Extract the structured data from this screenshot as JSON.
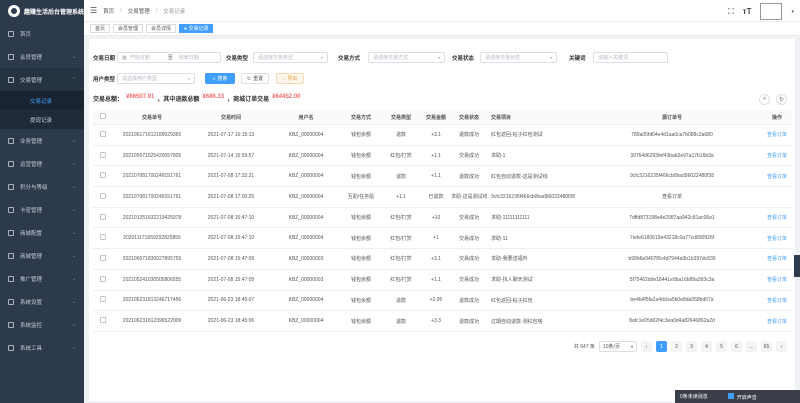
{
  "app": {
    "title": "趣赚生活后台管理系统"
  },
  "sidebar": {
    "items": [
      {
        "label": "首页",
        "icon": "home-icon"
      },
      {
        "label": "会员管理",
        "icon": "user-icon"
      },
      {
        "label": "交易管理",
        "icon": "trade-icon",
        "open": true
      },
      {
        "label": "业务管理",
        "icon": "business-icon"
      },
      {
        "label": "运营管理",
        "icon": "operation-icon"
      },
      {
        "label": "积分与等级",
        "icon": "points-icon"
      },
      {
        "label": "卡密管理",
        "icon": "card-icon"
      },
      {
        "label": "商城配置",
        "icon": "mall-config-icon"
      },
      {
        "label": "商城管理",
        "icon": "mall-icon"
      },
      {
        "label": "推广管理",
        "icon": "promotion-icon"
      },
      {
        "label": "系统设置",
        "icon": "settings-icon"
      },
      {
        "label": "系统监控",
        "icon": "monitor-icon"
      },
      {
        "label": "系统工具",
        "icon": "tools-icon"
      }
    ],
    "subitems": [
      {
        "label": "交易记录",
        "active": true
      },
      {
        "label": "提现记录",
        "active": false
      }
    ]
  },
  "topbar": {
    "breadcrumb": [
      "首页",
      "交易管理",
      "交易记录"
    ]
  },
  "tags": [
    {
      "label": "首页",
      "active": false
    },
    {
      "label": "会员管理",
      "active": false
    },
    {
      "label": "会员详情",
      "active": false
    },
    {
      "label": "● 交易记录",
      "active": true
    }
  ],
  "filters": {
    "date_label": "交易日期",
    "date_start": "开始日期",
    "date_sep": "至",
    "date_end": "结束日期",
    "type_label": "交易类型",
    "type_ph": "请选择交易类型",
    "method_label": "交易方式",
    "method_ph": "请选择交易方式",
    "status_label": "交易状态",
    "status_ph": "请选择交易状态",
    "keyword_label": "关键词",
    "keyword_ph": "请输入关键词",
    "usertype_label": "用户类型",
    "usertype_ph": "请选择用户类型",
    "search_btn": "搜索",
    "reset_btn": "重置",
    "export_btn": "导出"
  },
  "summary": {
    "prefix": "交易总额：",
    "total": "¥66507.91",
    "mid1": "，其中退款总额",
    "refund": "¥686.33",
    "mid2": "，商城订单交易",
    "mall": "¥64452.00"
  },
  "table": {
    "headers": [
      "交易单号",
      "交易时间",
      "用户名",
      "交易方式",
      "交易类型",
      "交易金额",
      "交易状态",
      "交易项目",
      "源订单号",
      "操作"
    ],
    "rows": [
      [
        "202106171612189029365",
        "2021-07-17 16:15:13",
        "KBZ_00000004",
        "钱包余额",
        "退款",
        "+3.1",
        "退款成功",
        "红包返回-帖子红包测试",
        "789a05fd64e4d1aa0ca7b088c2a680",
        "查看订单"
      ],
      [
        "202105071525420057805",
        "2021-07-14 15:59:57",
        "KBZ_00000004",
        "钱包余额",
        "红包/打赏",
        "+1.1",
        "交易成功",
        "求助-1",
        "39754d6293fef43bab2e97a17b16b3a",
        "查看订单"
      ],
      [
        "202107081700249151761",
        "2021-07-08 17:32:21",
        "KBZ_00000004",
        "钱包余额",
        "退款",
        "+1.1",
        "退款成功",
        "红包自动退款-这是测试线",
        "9cfc3216235f466cb0bad96022480f38",
        "查看订单"
      ],
      [
        "202107081700249151761",
        "2021-07-08 17:00:25",
        "KBZ_00000004",
        "互助/任务贴",
        "+1.1",
        "已退款",
        "求助-这是测试线",
        "9cfc3216235f466cb0bad96022480f38",
        "查看订单"
      ],
      [
        "202101251632219425978",
        "2021-07-08 15:47:10",
        "KBZ_00000004",
        "钱包余额",
        "红包/打赏",
        "+10",
        "交易成功",
        "求助-11111111111",
        "7dffd873198a4e2987aa942c81ac06e1",
        "查看订单"
      ],
      [
        "202011171659292825855",
        "2021-07-08 15:47:10",
        "KBZ_00000004",
        "钱包余额",
        "红包/打赏",
        "+1",
        "交易成功",
        "求助-11",
        "7ede6180619e43218c0a77cd890926f",
        "查看订单"
      ],
      [
        "202106071830027895759",
        "2021-07-08 15:47:09",
        "KBZ_00000003",
        "钱包余额",
        "红包/打赏",
        "+3.1",
        "交易成功",
        "求助-我要送福吟",
        "b99b6e9407f0c4d7944a9b1b397dc830",
        "查看订单"
      ],
      [
        "202105241030505806555",
        "2021-07-08 15:47:09",
        "KBZ_00000003",
        "钱包余额",
        "红包/打赏",
        "+1.1",
        "交易成功",
        "求助-找人聊天测试",
        "5f75462dde18441e9ba16b89a393c3a",
        "查看订单"
      ],
      [
        "202106231813246717456",
        "2021-06-23 18:45:07",
        "KBZ_00000004",
        "钱包余额",
        "退款",
        "+2.95",
        "退款成功",
        "红包返回-帖子红包",
        "be4b4f5fa2a4dcba5b0e8da058bd67a",
        "查看订单"
      ],
      [
        "202106231812396522009",
        "2021-06-23 18:45:06",
        "KBZ_00000004",
        "钱包余额",
        "退款",
        "+3.3",
        "退款成功",
        "过期自动退款-测红包啥",
        "8afc1e05d02f4c3ea0d4a82646862a2d",
        "查看订单"
      ]
    ]
  },
  "pager": {
    "total": "共 647 条",
    "size": "10条/页",
    "pages": [
      "1",
      "2",
      "3",
      "4",
      "5",
      "6",
      "...",
      "65"
    ],
    "active": "1"
  },
  "notify": {
    "text": "0条未读消息",
    "sound": "开启声音"
  },
  "colors": {
    "sidebar": "#2c3a4b",
    "accent": "#409eff",
    "danger": "#f56c6c"
  }
}
